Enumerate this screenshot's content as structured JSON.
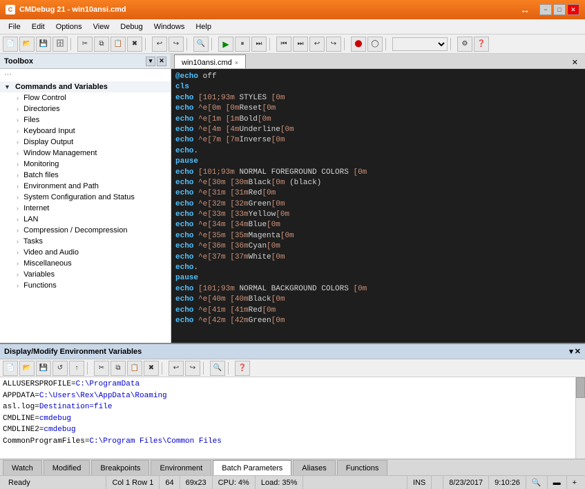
{
  "titlebar": {
    "icon": "C",
    "title": "CMDebug 21 - win10ansi.cmd",
    "minimize": "−",
    "maximize": "□",
    "close": "✕"
  },
  "menubar": {
    "items": [
      "File",
      "Edit",
      "Options",
      "View",
      "Debug",
      "Windows",
      "Help"
    ]
  },
  "toolbox": {
    "title": "Toolbox",
    "sections": [
      {
        "label": "Commands and Variables",
        "type": "group",
        "expanded": true
      },
      {
        "label": "Flow Control",
        "type": "item"
      },
      {
        "label": "Directories",
        "type": "item"
      },
      {
        "label": "Files",
        "type": "item"
      },
      {
        "label": "Keyboard Input",
        "type": "item"
      },
      {
        "label": "Display Output",
        "type": "item"
      },
      {
        "label": "Window Management",
        "type": "item"
      },
      {
        "label": "Monitoring",
        "type": "item"
      },
      {
        "label": "Batch files",
        "type": "item"
      },
      {
        "label": "Environment and Path",
        "type": "item"
      },
      {
        "label": "System Configuration and Status",
        "type": "item"
      },
      {
        "label": "Internet",
        "type": "item"
      },
      {
        "label": "LAN",
        "type": "item"
      },
      {
        "label": "Compression / Decompression",
        "type": "item"
      },
      {
        "label": "Tasks",
        "type": "item"
      },
      {
        "label": "Video and Audio",
        "type": "item"
      },
      {
        "label": "Miscellaneous",
        "type": "item"
      },
      {
        "label": "Variables",
        "type": "item"
      },
      {
        "label": "Functions",
        "type": "item"
      }
    ]
  },
  "editor": {
    "tab_name": "win10ansi.cmd",
    "close_icon": "×",
    "lines": [
      {
        "text": "@echo off",
        "type": "command"
      },
      {
        "text": "cls",
        "type": "command"
      },
      {
        "text": "echo [101;93m STYLES [0m",
        "type": "echo"
      },
      {
        "text": "echo ^e[0m [0mReset[0m",
        "type": "echo"
      },
      {
        "text": "echo ^e[1m [1mBold[0m",
        "type": "echo"
      },
      {
        "text": "echo ^e[4m [4mUnderline[0m",
        "type": "echo"
      },
      {
        "text": "echo ^e[7m [7mInverse[0m",
        "type": "echo"
      },
      {
        "text": "echo.",
        "type": "echo"
      },
      {
        "text": "pause",
        "type": "command"
      },
      {
        "text": "echo [101;93m NORMAL FOREGROUND COLORS [0m",
        "type": "echo"
      },
      {
        "text": "echo ^e[30m [30mBlack[0m (black)",
        "type": "echo"
      },
      {
        "text": "echo ^e[31m [31mRed[0m",
        "type": "echo"
      },
      {
        "text": "echo ^e[32m [32mGreen[0m",
        "type": "echo"
      },
      {
        "text": "echo ^e[33m [33mYellow[0m",
        "type": "echo"
      },
      {
        "text": "echo ^e[34m [34mBlue[0m",
        "type": "echo"
      },
      {
        "text": "echo ^e[35m [35mMagenta[0m",
        "type": "echo"
      },
      {
        "text": "echo ^e[36m [36mCyan[0m",
        "type": "echo"
      },
      {
        "text": "echo ^e[37m [37mWhite[0m",
        "type": "echo"
      },
      {
        "text": "echo.",
        "type": "echo"
      },
      {
        "text": "pause",
        "type": "command"
      },
      {
        "text": "echo [101;93m NORMAL BACKGROUND COLORS [0m",
        "type": "echo"
      },
      {
        "text": "echo ^e[40m [40mBlack[0m",
        "type": "echo"
      },
      {
        "text": "echo ^e[41m [41mRed[0m",
        "type": "echo"
      },
      {
        "text": "echo ^e[42m [42mGreen[0m",
        "type": "echo"
      }
    ]
  },
  "env_panel": {
    "title": "Display/Modify Environment Variables",
    "lines": [
      "ALLUSERSPROFILE=C:\\ProgramData",
      "APPDATA=C:\\Users\\Rex\\AppData\\Roaming",
      "asl.log=Destination=file",
      "CMDLINE=cmdebug",
      "CMDLINE2=cmdebug",
      "CommonProgramFiles=C:\\Program Files\\Common Files"
    ]
  },
  "bottom_tabs": {
    "items": [
      "Watch",
      "Modified",
      "Breakpoints",
      "Environment",
      "Batch Parameters",
      "Aliases",
      "Functions"
    ],
    "active": "Batch Parameters"
  },
  "statusbar": {
    "ready": "Ready",
    "col_row": "Col 1 Row 1",
    "num": "64",
    "size": "69x23",
    "cpu": "CPU: 4%",
    "load": "Load: 35%",
    "mode": "INS",
    "date": "8/23/2017",
    "time": "9:10:26"
  }
}
